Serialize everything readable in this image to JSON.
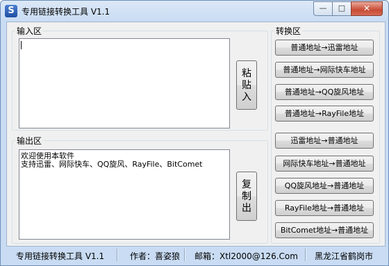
{
  "window": {
    "title": "专用链接转换工具 V1.1",
    "icon_letter": "S",
    "minimize": "—",
    "maximize": "□",
    "close": "✕"
  },
  "input_group": {
    "legend": "输入区",
    "value": ""
  },
  "output_group": {
    "legend": "输出区",
    "lines": [
      "欢迎使用本软件",
      "支持迅雷、网际快车、QQ旋风、RayFile、BitComet"
    ]
  },
  "paste_button": [
    "粘",
    "贴",
    "入"
  ],
  "copy_button": [
    "复",
    "制",
    "出"
  ],
  "convert_group": {
    "legend": "转换区",
    "buttons": [
      "普通地址→迅雷地址",
      "普通地址→网际快车地址",
      "普通地址→QQ旋风地址",
      "普通地址→RayFile地址",
      "迅雷地址→普通地址",
      "网际快车地址→普通地址",
      "QQ旋风地址→普通地址",
      "RayFile地址→普通地址",
      "BitComet地址→普通地址"
    ]
  },
  "statusbar": {
    "app": "专用链接转换工具 V1.1",
    "author": "作者：喜姿狼",
    "email": "邮箱：Xtl2000@126.Com",
    "location": "黑龙江省鹤岗市"
  }
}
